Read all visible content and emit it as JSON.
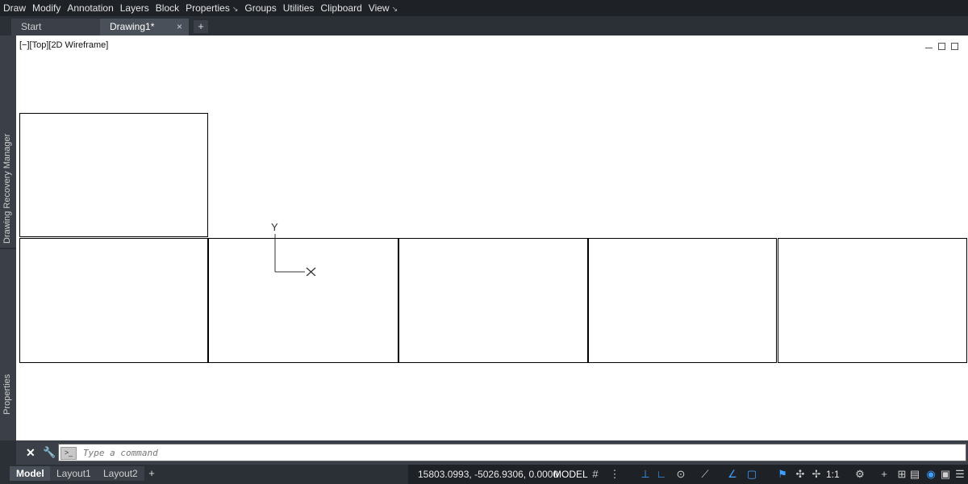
{
  "menu": [
    {
      "label": "Draw",
      "arrow": ""
    },
    {
      "label": "Modify",
      "arrow": ""
    },
    {
      "label": "Annotation",
      "arrow": ""
    },
    {
      "label": "Layers",
      "arrow": ""
    },
    {
      "label": "Block",
      "arrow": ""
    },
    {
      "label": "Properties",
      "arrow": "↘"
    },
    {
      "label": "Groups",
      "arrow": ""
    },
    {
      "label": "Utilities",
      "arrow": ""
    },
    {
      "label": "Clipboard",
      "arrow": ""
    },
    {
      "label": "View",
      "arrow": "↘"
    }
  ],
  "tabs": {
    "start": "Start",
    "drawing": "Drawing1*",
    "add": "+"
  },
  "side": {
    "top": "Drawing Recovery Manager",
    "bottom": "Properties"
  },
  "viewport": {
    "label": "[−][Top][2D Wireframe]"
  },
  "ucs": {
    "y": "Y"
  },
  "command": {
    "placeholder": "Type a command"
  },
  "layouts": {
    "model": "Model",
    "layout1": "Layout1",
    "layout2": "Layout2",
    "add": "+"
  },
  "status": {
    "coords": "15803.0993, -5026.9306, 0.0000",
    "space": "MODEL",
    "scale": "1:1"
  },
  "icons": [
    "close-icon",
    "wrench-icon",
    "command-prompt-icon",
    "grid-icon",
    "snap-icon",
    "ortho-icon",
    "polar-icon",
    "osnap-icon",
    "annotation-icon",
    "workspace-icon",
    "isolate-icon",
    "fullscreen-icon",
    "customize-icon"
  ],
  "colors": {
    "accent": "#3da0ff",
    "canvas": "#ffffff",
    "chrome": "#2b2f36"
  }
}
